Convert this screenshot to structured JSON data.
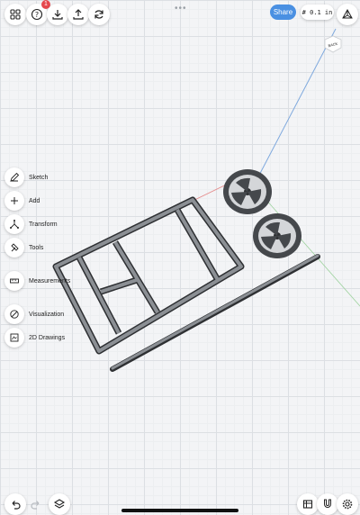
{
  "top_bar": {
    "help_badge": "1",
    "drag_handle": "•••",
    "share_label": "Share",
    "grid_label": "# 0.1 in"
  },
  "view_cube": {
    "face_label": "BACK"
  },
  "tools": [
    {
      "label": "Sketch",
      "icon": "pencil-icon"
    },
    {
      "label": "Add",
      "icon": "plus-icon"
    },
    {
      "label": "Transform",
      "icon": "transform-icon"
    },
    {
      "label": "Tools",
      "icon": "hammer-icon"
    },
    {
      "label": "Measurements",
      "icon": "ruler-icon"
    },
    {
      "label": "Visualization",
      "icon": "visualization-icon"
    },
    {
      "label": "2D Drawings",
      "icon": "drawing-icon"
    }
  ],
  "colors": {
    "accent": "#4a90e2",
    "badge": "#e5484d",
    "model": "#55585c"
  }
}
